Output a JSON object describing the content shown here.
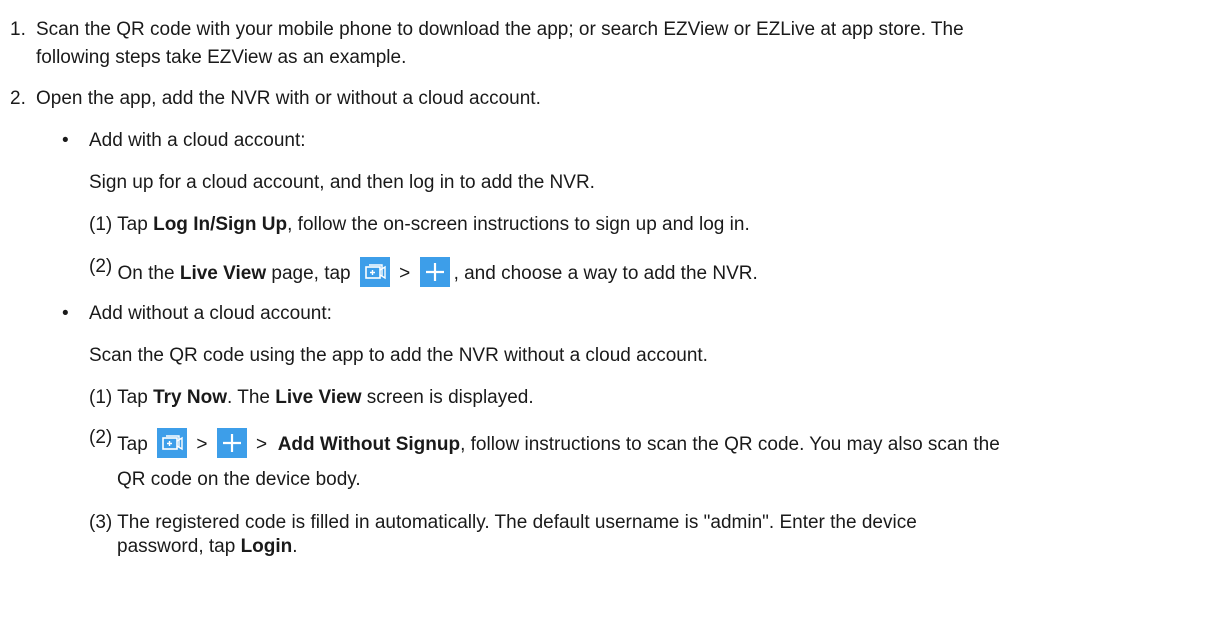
{
  "step1": {
    "number": "1.",
    "line1": "Scan the QR code with your mobile phone to download the app; or search EZView or EZLive at app store. The",
    "line2": "following steps take EZView as an example."
  },
  "step2": {
    "number": "2.",
    "text": "Open the app, add the NVR with or without a cloud account.",
    "with_account": {
      "bullet": "•",
      "heading": "Add with a cloud account:",
      "intro": "Sign up for a cloud account, and then log in to add the NVR.",
      "sub1": {
        "num": "(1)",
        "pre": "Tap ",
        "bold": "Log In/Sign Up",
        "post": ", follow the on-screen instructions to sign up and log in."
      },
      "sub2": {
        "num": "(2)",
        "pre": "On the ",
        "bold": "Live View",
        "mid": " page, tap ",
        "sep": ">",
        "post": ", and choose a way to add the NVR."
      }
    },
    "without_account": {
      "bullet": "•",
      "heading": "Add without a cloud account:",
      "intro": "Scan the QR code using the app to add the NVR without a cloud account.",
      "sub1": {
        "num": "(1)",
        "pre": "Tap ",
        "bold1": "Try Now",
        "mid": ". The ",
        "bold2": "Live View",
        "post": " screen is displayed."
      },
      "sub2": {
        "num": "(2)",
        "pre": "Tap",
        "sep1": ">",
        "sep2": ">",
        "bold": "Add Without Signup",
        "post": ", follow instructions to scan the QR code. You may also scan the",
        "line2": "QR code on the device body."
      },
      "sub3": {
        "num": "(3)",
        "line1": "The registered code is filled in automatically. The default username is \"admin\". Enter the device",
        "line2_pre": "password, tap ",
        "line2_bold": "Login",
        "line2_post": "."
      }
    }
  },
  "icons": {
    "device_icon": "device-add-icon",
    "plus_icon": "plus-icon",
    "color": "#3d9ee9"
  }
}
